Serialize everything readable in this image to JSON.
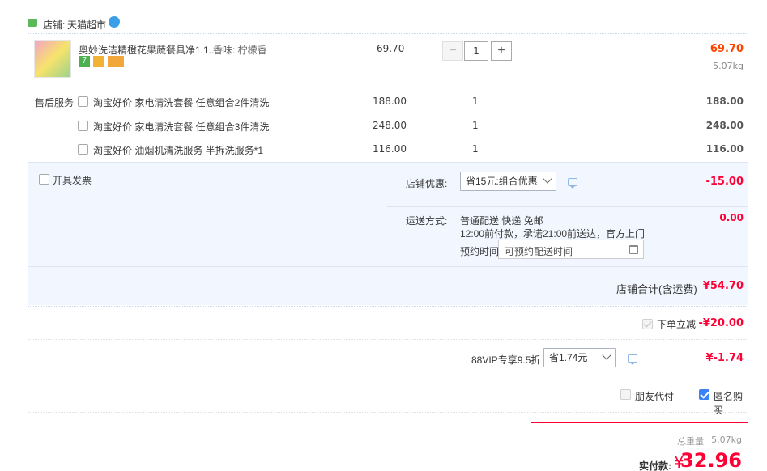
{
  "shop": {
    "label": "店铺: ",
    "name": "天猫超市"
  },
  "product": {
    "title": "奥妙洗洁精橙花果蔬餐具净1.1...",
    "sku": "香味: 柠檬香",
    "unit_price": "69.70",
    "quantity": "1",
    "subtotal": "69.70",
    "weight": "5.07kg",
    "minus_label": "−",
    "plus_label": "+"
  },
  "after_sales": {
    "label": "售后服务",
    "items": [
      {
        "name": "淘宝好价 家电清洗套餐 任意组合2件清洗",
        "price": "188.00",
        "qty": "1",
        "total": "188.00"
      },
      {
        "name": "淘宝好价 家电清洗套餐 任意组合3件清洗",
        "price": "248.00",
        "qty": "1",
        "total": "248.00"
      },
      {
        "name": "淘宝好价 油烟机清洗服务 半拆洗服务*1",
        "price": "116.00",
        "qty": "1",
        "total": "116.00"
      }
    ]
  },
  "invoice": {
    "label": "开具发票"
  },
  "shop_discount": {
    "label": "店铺优惠:",
    "selected": "省15元:组合优惠",
    "amount": "-15.00"
  },
  "delivery": {
    "label": "运送方式:",
    "line1": "普通配送 快递 免邮",
    "line2": "12:00前付款，承诺21:00前送达，官方上门",
    "schedule_label": "预约时间",
    "schedule_placeholder": "可预约配送时间",
    "fee": "0.00"
  },
  "shop_total": {
    "label": "店铺合计(含运费)",
    "amount": "¥54.70"
  },
  "instant_discount": {
    "label": "下单立减",
    "amount": "-¥20.00"
  },
  "vip": {
    "label": "88VIP专享9.5折",
    "selected": "省1.74元",
    "amount": "¥-1.74"
  },
  "options": {
    "friend_pay": "朋友代付",
    "anonymous": "匿名购买"
  },
  "summary": {
    "weight_label": "总重量: ",
    "weight": "5.07kg",
    "pay_label": "实付款: ",
    "currency": "¥",
    "pay_amount": "32.96"
  },
  "colors": {
    "accent": "#ff0036",
    "price_red": "#f40",
    "panel_bg": "#f2f7ff"
  }
}
